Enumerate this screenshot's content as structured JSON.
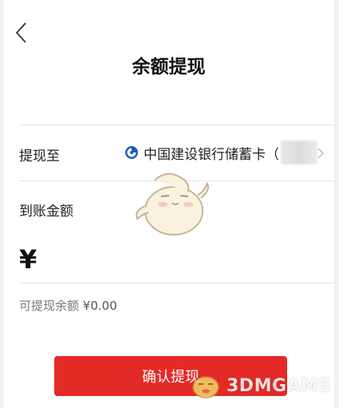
{
  "header": {
    "back_icon": "chevron-left-icon",
    "title": "余额提现"
  },
  "withdraw_to": {
    "label": "提现至",
    "bank_icon": "ccb-logo-icon",
    "bank_name": "中国建设银行储蓄卡（",
    "chevron_icon": "chevron-right-icon"
  },
  "amount": {
    "label": "到账金额",
    "currency": "¥",
    "value": ""
  },
  "available": {
    "label": "可提现余额",
    "value": "¥0.00"
  },
  "confirm_button": {
    "label": "确认提现"
  },
  "watermark": {
    "text": "3DMGAME"
  },
  "colors": {
    "accent": "#e42a27",
    "bank_blue": "#1b5fb5",
    "divider": "#e6e6e6"
  }
}
